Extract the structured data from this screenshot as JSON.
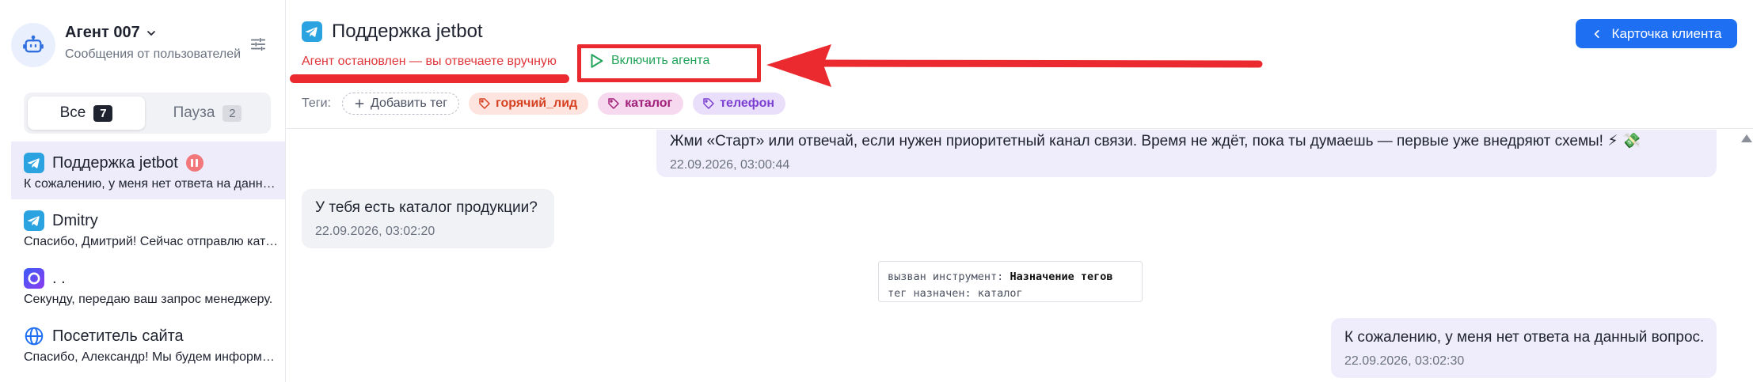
{
  "sidebar": {
    "agent_name": "Агент 007",
    "agent_subtitle": "Сообщения от пользователей",
    "tabs": [
      {
        "label": "Все",
        "count": "7",
        "active": true
      },
      {
        "label": "Пауза",
        "count": "2",
        "active": false
      }
    ],
    "chats": [
      {
        "channel": "telegram",
        "title": "Поддержка jetbot",
        "preview": "К сожалению, у меня нет ответа на данный вопрос.",
        "paused": true,
        "active": true
      },
      {
        "channel": "telegram",
        "title": "Dmitry",
        "preview": "Спасибо, Дмитрий! Сейчас отправлю каталог.",
        "paused": false,
        "active": false
      },
      {
        "channel": "max",
        "title": ". .",
        "preview": "Секунду, передаю ваш запрос менеджеру.",
        "paused": false,
        "active": false
      },
      {
        "channel": "web",
        "title": "Посетитель сайта",
        "preview": "Спасибо, Александр! Мы будем информировать вас.",
        "paused": false,
        "active": false
      }
    ]
  },
  "header": {
    "title": "Поддержка jetbot",
    "status": "Агент остановлен — вы отвечаете вручную",
    "enable_label": "Включить агента",
    "client_card_label": "Карточка клиента"
  },
  "tags": {
    "label": "Теги:",
    "add_label": "Добавить тег",
    "items": [
      "горячий_лид",
      "каталог",
      "телефон"
    ]
  },
  "messages": [
    {
      "direction": "out",
      "text": "Жми «Старт» или отвечай, если нужен приоритетный канал связи. Время не ждёт, пока ты думаешь — первые уже внедряют схемы! ⚡ 💸",
      "time": "22.09.2026, 03:00:44"
    },
    {
      "direction": "in",
      "text": "У тебя есть каталог продукции?",
      "time": "22.09.2026, 03:02:20"
    },
    {
      "direction": "tool",
      "line1_prefix": "вызван инструмент:",
      "line1_value": "Назначение тегов",
      "line2": "тег назначен: каталог"
    },
    {
      "direction": "out",
      "text": "К сожалению, у меня нет ответа на данный вопрос.",
      "time": "22.09.2026, 03:02:30"
    }
  ],
  "colors": {
    "accent": "#1f6ff2",
    "annotation_red": "#ea2a2f",
    "status_red": "#e0363a",
    "enable_green": "#22a35a",
    "outgoing_bubble": "#efedfb",
    "incoming_bubble": "#f1f2f5"
  }
}
